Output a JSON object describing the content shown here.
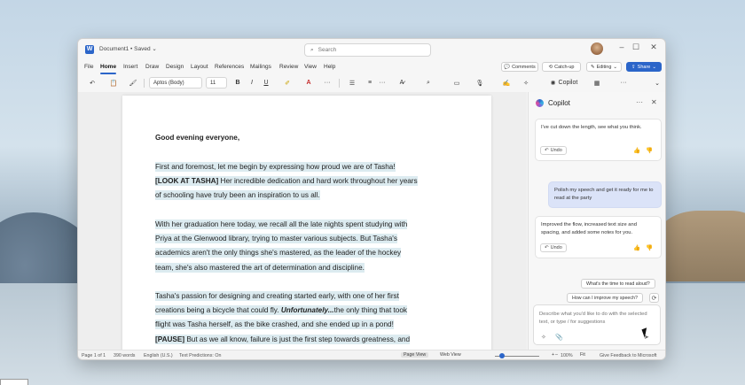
{
  "window": {
    "doc_title": "Document1 • Saved ⌄",
    "search_placeholder": "Search"
  },
  "menu": {
    "items": [
      "File",
      "Home",
      "Insert",
      "Draw",
      "Design",
      "Layout",
      "References",
      "Mailings",
      "Review",
      "View",
      "Help"
    ],
    "active": "Home"
  },
  "ribbon_buttons": {
    "comments": "Comments",
    "catchup": "Catch-up",
    "editing": "Editing",
    "share": "Share"
  },
  "toolbar": {
    "font_name": "Aptos (Body)",
    "font_size": "11",
    "bold": "B",
    "italic": "I",
    "underline": "U",
    "copilot": "Copilot"
  },
  "document": {
    "greeting": "Good evening everyone,",
    "p1_a": "First and foremost, let me begin by expressing how proud we are of Tasha!",
    "p1_b_bold": "[LOOK AT TASHA]",
    "p1_b": " Her incredible dedication and hard work throughout her years",
    "p1_c": "of schooling have truly been an inspiration to us all.",
    "p2_a": "With her graduation here today, we recall all the late nights spent studying with",
    "p2_b": "Priya at the Glenwood library, trying to master various subjects. But Tasha's",
    "p2_c": "academics aren't the only things she's mastered, as the leader of the hockey",
    "p2_d": "team, she's also mastered the art of determination and discipline.",
    "p3_a": "Tasha's passion for designing and creating started early, with one of her first",
    "p3_b": "creations being a bicycle that could fly. ",
    "p3_b_em": "Unfortunately...",
    "p3_b2": "the only thing that took",
    "p3_c": "flight was Tasha herself, as the bike crashed, and she ended up in a pond!",
    "p3_d_bold": "[PAUSE]",
    "p3_d": " But as we all know, failure is just the first step towards greatness, and"
  },
  "status_bar": {
    "page": "Page 1 of 1",
    "words": "390 words",
    "language": "English (U.S.)",
    "predictions": "Text Predictions: On",
    "page_view": "Page View",
    "web_view": "Web View",
    "zoom": "100%",
    "fit": "Fit",
    "feedback": "Give Feedback to Microsoft"
  },
  "copilot": {
    "title": "Copilot",
    "messages": [
      {
        "role": "assistant",
        "text": "I've cut down the length, see what you think."
      },
      {
        "role": "user",
        "text": "Polish my speech and get it ready for me to read at the party"
      },
      {
        "role": "assistant",
        "text": "Improved the flow, increased text size and spacing, and added some notes for you."
      }
    ],
    "undo_label": "Undo",
    "suggestions": [
      "What's the time to read aloud?",
      "How can I improve my speech?"
    ],
    "input_placeholder": "Describe what you'd like to do with the selected text, or type / for suggestions"
  },
  "colors": {
    "accent": "#2b65c9",
    "highlight": "#dcebf0",
    "user_bubble": "#dbe3f8"
  }
}
